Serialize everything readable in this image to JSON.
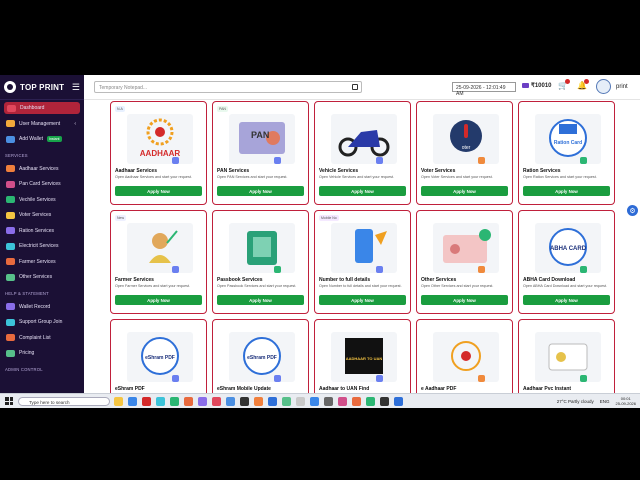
{
  "brand": "TOP PRINT",
  "sidebar": {
    "items": [
      {
        "label": "Dashboard",
        "active": true
      },
      {
        "label": "User Management",
        "caret": "‹"
      },
      {
        "label": "Add Wallet",
        "badge": "Instant"
      }
    ],
    "services_heading": "SERVICES",
    "services": [
      "Aadhaar Services",
      "Pan Card Services",
      "Vechile Services",
      "Voter Services",
      "Ration Services",
      "Electricit Services",
      "Farmer Services",
      "Other Services"
    ],
    "help_heading": "HELP & STATEMENT",
    "help": [
      "Wallet Record",
      "Support Group Join",
      "Complaint List",
      "Pricing"
    ],
    "admin_heading": "ADMIN CONTROL"
  },
  "topbar": {
    "notepad_placeholder": "Temporary Notepad...",
    "datetime": "25-09-2026 - 12:01:49 AM",
    "wallet": "₹10010",
    "notif1": "0",
    "notif2": "0",
    "username": "print"
  },
  "cards": [
    {
      "tag": "N.A",
      "title": "Aadhaar Services",
      "desc": "Open Aadhaar Services and start your request.",
      "button": "Apply Now",
      "icon_text": "AADHAAR",
      "icon": "aadhaar-logo"
    },
    {
      "tag": "PAN",
      "title": "PAN Services",
      "desc": "Open PAN Services and start your request.",
      "button": "Apply Now",
      "icon_text": "PAN",
      "icon": "pan-card"
    },
    {
      "tag": "",
      "title": "Vehicle Services",
      "desc": "Open Vehicle Services and start your request.",
      "button": "Apply Now",
      "icon_text": "",
      "icon": "motorbike"
    },
    {
      "tag": "",
      "title": "Voter Services",
      "desc": "Open Voter Services and start your request.",
      "button": "Apply Now",
      "icon_text": "oter",
      "icon": "voter-finger"
    },
    {
      "tag": "",
      "title": "Ration Services",
      "desc": "Open Ration Services and start your request.",
      "button": "Apply Now",
      "icon_text": "Ration Card",
      "icon": "ration-card"
    },
    {
      "tag": "New",
      "title": "Farmer Services",
      "desc": "Open Farmer Services and start your request.",
      "button": "Apply Now",
      "icon_text": "",
      "icon": "farmer"
    },
    {
      "tag": "",
      "title": "Passbook Services",
      "desc": "Open Passbook Services and start your request.",
      "button": "Apply Now",
      "icon_text": "",
      "icon": "passbook"
    },
    {
      "tag": "Mobile No",
      "title": "Number to full details",
      "desc": "Open Number to full details and start your request.",
      "button": "Apply Now",
      "icon_text": "",
      "icon": "phone"
    },
    {
      "tag": "",
      "title": "Other Services",
      "desc": "Open Other Services and start your request.",
      "button": "Apply Now",
      "icon_text": "",
      "icon": "id-card"
    },
    {
      "tag": "",
      "title": "ABHA Card Download",
      "desc": "Open ABHA Card Download and start your request.",
      "button": "Apply Now",
      "icon_text": "ABHA CARD",
      "icon": "abha"
    },
    {
      "tag": "",
      "title": "eShram PDF",
      "desc": "",
      "button": "",
      "icon_text": "eShram PDF",
      "icon": "eshram"
    },
    {
      "tag": "",
      "title": "eShram Mobile Update",
      "desc": "",
      "button": "",
      "icon_text": "eShram PDF",
      "icon": "eshram"
    },
    {
      "tag": "",
      "title": "Aadhaar to UAN Find",
      "desc": "",
      "button": "",
      "icon_text": "AADHAAR TO UAN",
      "icon": "uan"
    },
    {
      "tag": "",
      "title": "e Aadhaar PDF",
      "desc": "",
      "button": "",
      "icon_text": "",
      "icon": "eaadhaar"
    },
    {
      "tag": "",
      "title": "Aadhaar Pvc Instant",
      "desc": "",
      "button": "",
      "icon_text": "",
      "icon": "pvc"
    }
  ],
  "taskbar": {
    "search_placeholder": "Type here to search",
    "weather": "27°C  Partly cloudy",
    "lang": "ENG",
    "time": "00:01",
    "date": "25-09-2026"
  },
  "colors": {
    "sidebar": "#1b1035",
    "accent": "#c0203b",
    "button": "#1a9d3f"
  }
}
